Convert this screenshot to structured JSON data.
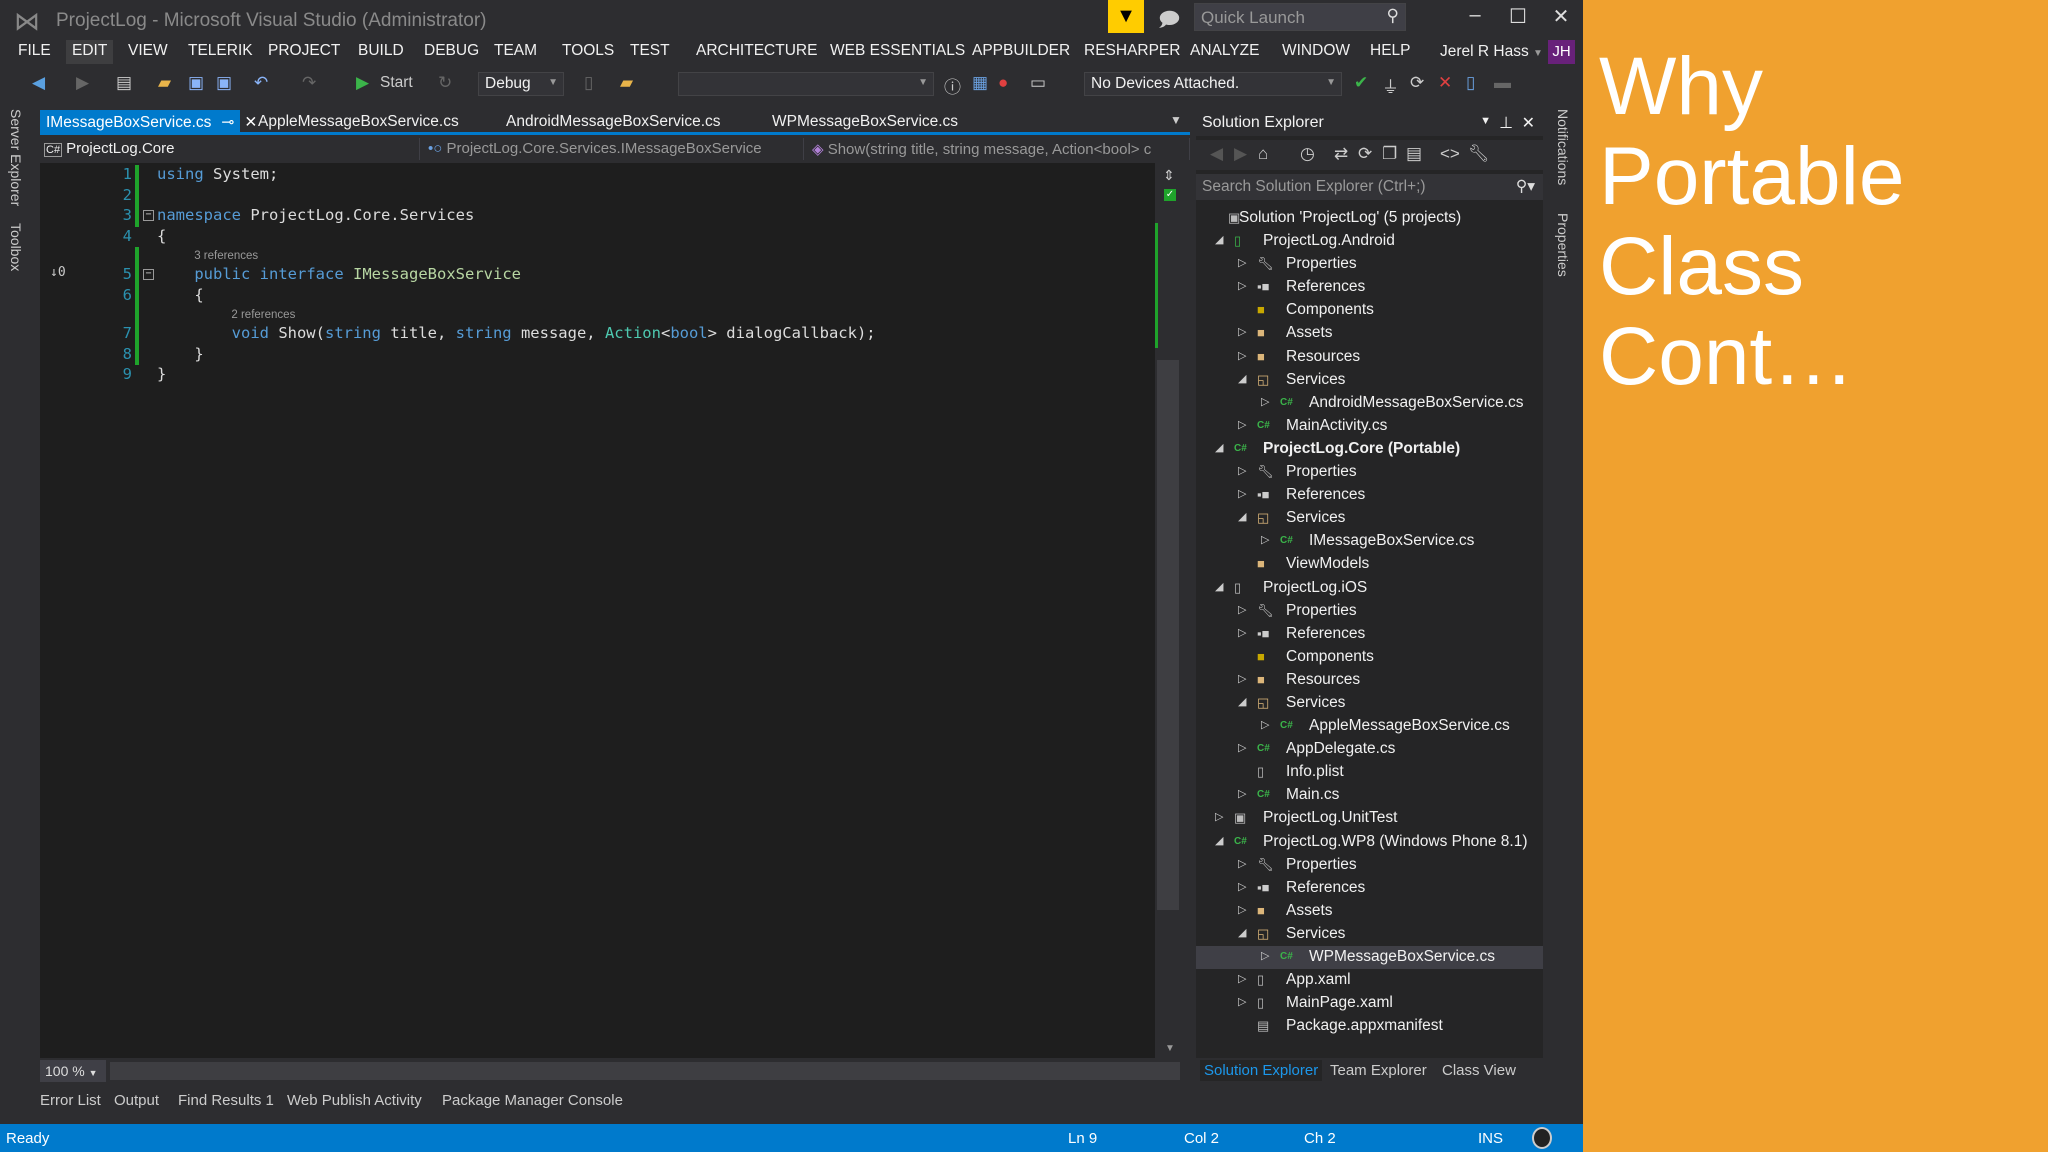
{
  "window": {
    "title": "ProjectLog - Microsoft Visual Studio (Administrator)",
    "quick_launch_placeholder": "Quick Launch"
  },
  "menu": [
    "FILE",
    "EDIT",
    "VIEW",
    "TELERIK",
    "PROJECT",
    "BUILD",
    "DEBUG",
    "TEAM",
    "TOOLS",
    "TEST",
    "ARCHITECTURE",
    "WEB ESSENTIALS",
    "APPBUILDER",
    "RESHARPER",
    "ANALYZE",
    "WINDOW",
    "HELP"
  ],
  "user": {
    "name": "Jerel R Hass",
    "initials": "JH"
  },
  "toolbar": {
    "start_label": "Start",
    "config": "Debug",
    "platform": "",
    "devices": "No Devices Attached."
  },
  "tabs": [
    {
      "label": "IMessageBoxService.cs",
      "active": true
    },
    {
      "label": "AppleMessageBoxService.cs"
    },
    {
      "label": "AndroidMessageBoxService.cs"
    },
    {
      "label": "WPMessageBoxService.cs"
    }
  ],
  "navbar": {
    "project": "ProjectLog.Core",
    "type": "ProjectLog.Core.Services.IMessageBoxService",
    "member": "Show(string title, string message, Action<bool> c"
  },
  "left_strip": [
    "Server Explorer",
    "Toolbox"
  ],
  "right_strip": [
    "Notifications",
    "Properties"
  ],
  "code": {
    "lines": [
      {
        "n": "1",
        "tokens": [
          {
            "t": "using",
            "c": "kw"
          },
          {
            "t": " System;"
          }
        ]
      },
      {
        "n": "2",
        "tokens": []
      },
      {
        "n": "3",
        "fold": true,
        "tokens": [
          {
            "t": "namespace",
            "c": "kw"
          },
          {
            "t": " ProjectLog.Core.Services"
          }
        ]
      },
      {
        "n": "4",
        "tokens": [
          {
            "t": "{"
          }
        ]
      },
      {
        "lens": "3 references",
        "indent": "    "
      },
      {
        "n": "5",
        "fold": true,
        "marker": "↓0",
        "tokens": [
          {
            "t": "    "
          },
          {
            "t": "public",
            "c": "kw"
          },
          {
            "t": " "
          },
          {
            "t": "interface",
            "c": "kw"
          },
          {
            "t": " "
          },
          {
            "t": "IMessageBoxService",
            "c": "if"
          }
        ]
      },
      {
        "n": "6",
        "tokens": [
          {
            "t": "    {"
          }
        ]
      },
      {
        "lens": "2 references",
        "indent": "        "
      },
      {
        "n": "7",
        "tokens": [
          {
            "t": "        "
          },
          {
            "t": "void",
            "c": "kw"
          },
          {
            "t": " Show("
          },
          {
            "t": "string",
            "c": "kw"
          },
          {
            "t": " title, "
          },
          {
            "t": "string",
            "c": "kw"
          },
          {
            "t": " message, "
          },
          {
            "t": "Action",
            "c": "ty"
          },
          {
            "t": "<"
          },
          {
            "t": "bool",
            "c": "kw"
          },
          {
            "t": "> dialogCallback);"
          }
        ]
      },
      {
        "n": "8",
        "tokens": [
          {
            "t": "    }"
          }
        ]
      },
      {
        "n": "9",
        "tokens": [
          {
            "t": "}"
          }
        ]
      }
    ]
  },
  "editor": {
    "zoom": "100 %"
  },
  "bottom_tabs": [
    "Error List",
    "Output",
    "Find Results 1",
    "Web Publish Activity",
    "Package Manager Console"
  ],
  "status": {
    "state": "Ready",
    "ln": "Ln 9",
    "col": "Col 2",
    "ch": "Ch 2",
    "mode": "INS"
  },
  "solution_explorer": {
    "title": "Solution Explorer",
    "search_placeholder": "Search Solution Explorer (Ctrl+;)",
    "items": [
      {
        "label": "Solution 'ProjectLog' (5 projects)",
        "level": 0,
        "exp": "none",
        "icon": "solution"
      },
      {
        "label": "ProjectLog.Android",
        "level": 0,
        "exp": "open",
        "icon": "android-project"
      },
      {
        "label": "Properties",
        "level": 1,
        "exp": "closed",
        "icon": "wrench"
      },
      {
        "label": "References",
        "level": 1,
        "exp": "closed",
        "icon": "references"
      },
      {
        "label": "Components",
        "level": 1,
        "exp": "none",
        "icon": "components"
      },
      {
        "label": "Assets",
        "level": 1,
        "exp": "closed",
        "icon": "folder"
      },
      {
        "label": "Resources",
        "level": 1,
        "exp": "closed",
        "icon": "folder"
      },
      {
        "label": "Services",
        "level": 1,
        "exp": "open",
        "icon": "folder-open"
      },
      {
        "label": "AndroidMessageBoxService.cs",
        "level": 2,
        "exp": "closed",
        "icon": "csharp-file"
      },
      {
        "label": "MainActivity.cs",
        "level": 1,
        "exp": "closed",
        "icon": "csharp-file"
      },
      {
        "label": "ProjectLog.Core (Portable)",
        "level": 0,
        "exp": "open",
        "icon": "csharp-project",
        "bold": true
      },
      {
        "label": "Properties",
        "level": 1,
        "exp": "closed",
        "icon": "wrench"
      },
      {
        "label": "References",
        "level": 1,
        "exp": "closed",
        "icon": "references"
      },
      {
        "label": "Services",
        "level": 1,
        "exp": "open",
        "icon": "folder-open"
      },
      {
        "label": "IMessageBoxService.cs",
        "level": 2,
        "exp": "closed",
        "icon": "csharp-file"
      },
      {
        "label": "ViewModels",
        "level": 1,
        "exp": "none",
        "icon": "folder"
      },
      {
        "label": "ProjectLog.iOS",
        "level": 0,
        "exp": "open",
        "icon": "ios-project"
      },
      {
        "label": "Properties",
        "level": 1,
        "exp": "closed",
        "icon": "wrench"
      },
      {
        "label": "References",
        "level": 1,
        "exp": "closed",
        "icon": "references"
      },
      {
        "label": "Components",
        "level": 1,
        "exp": "none",
        "icon": "components"
      },
      {
        "label": "Resources",
        "level": 1,
        "exp": "closed",
        "icon": "folder"
      },
      {
        "label": "Services",
        "level": 1,
        "exp": "open",
        "icon": "folder-open"
      },
      {
        "label": "AppleMessageBoxService.cs",
        "level": 2,
        "exp": "closed",
        "icon": "csharp-file"
      },
      {
        "label": "AppDelegate.cs",
        "level": 1,
        "exp": "closed",
        "icon": "csharp-file"
      },
      {
        "label": "Info.plist",
        "level": 1,
        "exp": "none",
        "icon": "file"
      },
      {
        "label": "Main.cs",
        "level": 1,
        "exp": "closed",
        "icon": "csharp-file"
      },
      {
        "label": "ProjectLog.UnitTest",
        "level": 0,
        "exp": "closed",
        "icon": "test-project"
      },
      {
        "label": "ProjectLog.WP8 (Windows Phone 8.1)",
        "level": 0,
        "exp": "open",
        "icon": "csharp-project"
      },
      {
        "label": "Properties",
        "level": 1,
        "exp": "closed",
        "icon": "wrench"
      },
      {
        "label": "References",
        "level": 1,
        "exp": "closed",
        "icon": "references"
      },
      {
        "label": "Assets",
        "level": 1,
        "exp": "closed",
        "icon": "folder"
      },
      {
        "label": "Services",
        "level": 1,
        "exp": "open",
        "icon": "folder-open"
      },
      {
        "label": "WPMessageBoxService.cs",
        "level": 2,
        "exp": "closed",
        "icon": "csharp-file",
        "selected": true
      },
      {
        "label": "App.xaml",
        "level": 1,
        "exp": "closed",
        "icon": "xaml-file"
      },
      {
        "label": "MainPage.xaml",
        "level": 1,
        "exp": "closed",
        "icon": "xaml-file"
      },
      {
        "label": "Package.appxmanifest",
        "level": 1,
        "exp": "none",
        "icon": "manifest-file"
      }
    ],
    "tabs": [
      "Solution Explorer",
      "Team Explorer",
      "Class View"
    ]
  },
  "slide": {
    "title": "Why Portable Class Cont…"
  },
  "colors": {
    "accent": "#007ACC",
    "slide_bg": "#F0A12F",
    "selected_tab_text": "#1C97EA"
  }
}
